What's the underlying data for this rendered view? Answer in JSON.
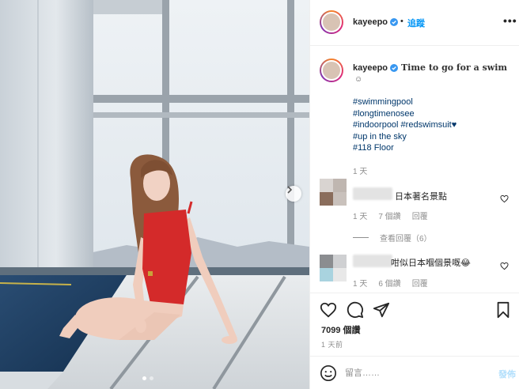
{
  "header": {
    "username": "kayeepo",
    "separator": "•",
    "follow_label": "追蹤",
    "more_label": "•••"
  },
  "caption": {
    "username": "kayeepo",
    "text": "Time to go for a swim",
    "emoji": "☺",
    "hashtags": [
      "#swimmingpool",
      "#longtimenosee",
      "#indoorpool #redswimsuit♥",
      "#up in the sky",
      "#118 Floor"
    ],
    "time": "1 天"
  },
  "comments": [
    {
      "text": "日本著名景點",
      "time": "1 天",
      "likes": "7 個讚",
      "reply": "回覆"
    },
    {
      "text": "咁似日本嗰個景嘅😂",
      "time": "1 天",
      "likes": "6 個讚",
      "reply": "回覆"
    }
  ],
  "view_replies": "查看回覆（6）",
  "actions": {
    "like_count": "7099 個讚",
    "post_time": "1 天前"
  },
  "add_comment": {
    "placeholder": "留言……",
    "post_label": "發佈"
  },
  "colors": {
    "link_blue": "#0095f6",
    "hashtag": "#00376b",
    "swimsuit_red": "#d42a2a"
  },
  "icons": [
    "verified-badge-icon",
    "heart-icon",
    "comment-icon",
    "share-icon",
    "bookmark-icon",
    "smile-icon",
    "chevron-right-icon"
  ]
}
